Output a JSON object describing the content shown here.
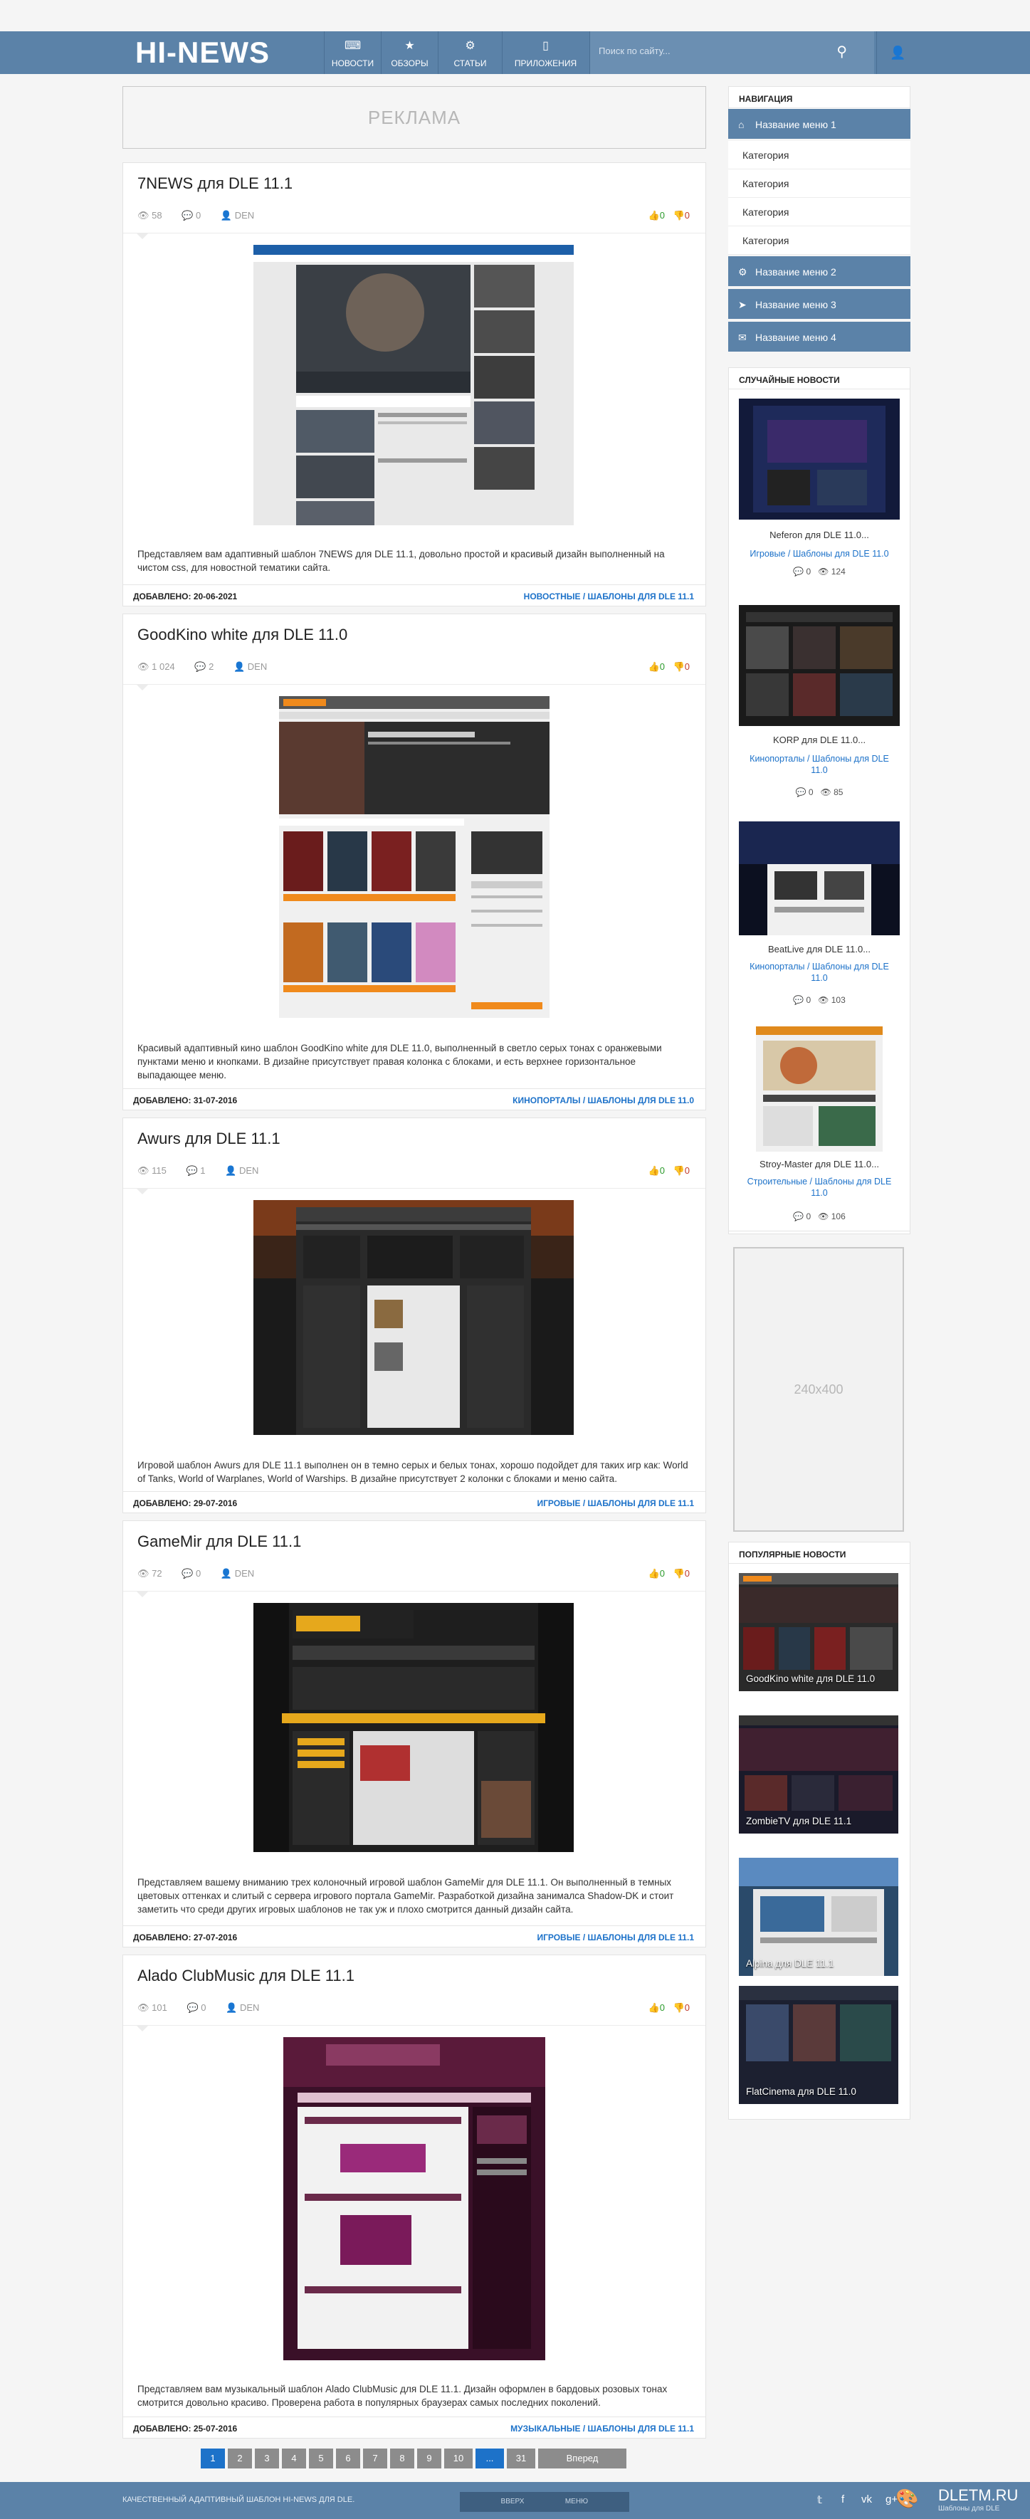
{
  "header": {
    "logo": "HI-NEWS",
    "nav": [
      {
        "label": "НОВОСТИ",
        "icon": "gamepad-icon"
      },
      {
        "label": "ОБЗОРЫ",
        "icon": "star-icon"
      },
      {
        "label": "СТАТЬИ",
        "icon": "gear-icon"
      },
      {
        "label": "ПРИЛОЖЕНИЯ",
        "icon": "phone-icon"
      }
    ],
    "search_placeholder": "Поиск по сайту...",
    "colors": {
      "bar": "#5b82a8",
      "accent": "#1d72c9"
    }
  },
  "ad": {
    "label": "РЕКЛАМА"
  },
  "posts": [
    {
      "title": "7NEWS для DLE 11.1",
      "views": "58",
      "comments": "0",
      "author": "DEN",
      "likes": "0",
      "dislikes": "0",
      "text": "Представляем вам адаптивный шаблон 7NEWS для DLE 11.1, довольно простой и красивый дизайн выполненный на чистом css, для новостной тематики сайта.",
      "date": "ДОБАВЛЕНО: 20-06-2021",
      "category": "НОВОСТНЫЕ / ШАБЛОНЫ ДЛЯ DLE 11.1"
    },
    {
      "title": "GoodKino white для DLE 11.0",
      "views": "1 024",
      "comments": "2",
      "author": "DEN",
      "likes": "0",
      "dislikes": "0",
      "text": "Красивый адаптивный кино шаблон GoodKino white для DLE 11.0, выполненный в светло серых тонах с оранжевыми пунктами меню и кнопками. В дизайне присутствует правая колонка с блоками, и есть верхнее горизонтальное выпадающее меню.",
      "date": "ДОБАВЛЕНО: 31-07-2016",
      "category": "КИНОПОРТАЛЫ / ШАБЛОНЫ ДЛЯ DLE 11.0"
    },
    {
      "title": "Awurs для DLE 11.1",
      "views": "115",
      "comments": "1",
      "author": "DEN",
      "likes": "0",
      "dislikes": "0",
      "text": "Игровой шаблон Awurs для DLE 11.1 выполнен он в темно серых и белых тонах, хорошо подойдет для таких игр как: World of Tanks, World of Warplanes, World of Warships. В дизайне присутствует 2 колонки с блоками и меню сайта.",
      "date": "ДОБАВЛЕНО: 29-07-2016",
      "category": "ИГРОВЫЕ / ШАБЛОНЫ ДЛЯ DLE 11.1"
    },
    {
      "title": "GameMir для DLE 11.1",
      "views": "72",
      "comments": "0",
      "author": "DEN",
      "likes": "0",
      "dislikes": "0",
      "text": "Представляем вашему вниманию трех колоночный игровой шаблон GameMir для DLE 11.1. Он выполненный в темных цветовых оттенках и слитый с сервера игрового портала GameMir. Разработкой дизайна занималса Shadow-DK и стоит заметить что среди других игровых шаблонов не так уж и плохо смотрится данный дизайн сайта.",
      "date": "ДОБАВЛЕНО: 27-07-2016",
      "category": "ИГРОВЫЕ / ШАБЛОНЫ ДЛЯ DLE 11.1"
    },
    {
      "title": "Alado ClubMusic для DLE 11.1",
      "views": "101",
      "comments": "0",
      "author": "DEN",
      "likes": "0",
      "dislikes": "0",
      "text": "Представляем вам музыкальный шаблон Alado ClubMusic для DLE 11.1. Дизайн оформлен в бардовых розовых тонах смотрится довольно красиво. Проверена работа в популярных браузерах самых последних поколений.",
      "date": "ДОБАВЛЕНО: 25-07-2016",
      "category": "МУЗЫКАЛЬНЫЕ / ШАБЛОНЫ ДЛЯ DLE 11.1"
    }
  ],
  "sidebar": {
    "nav_title": "НАВИГАЦИЯ",
    "menu": [
      {
        "label": "Название меню 1",
        "icon": "home-icon"
      },
      {
        "label": "Название меню 2",
        "icon": "gear-icon"
      },
      {
        "label": "Название меню 3",
        "icon": "location-arrow-icon"
      },
      {
        "label": "Название меню 4",
        "icon": "envelope-icon"
      }
    ],
    "submenu": [
      "Категория",
      "Категория",
      "Категория",
      "Категория"
    ],
    "random_title": "СЛУЧАЙНЫЕ НОВОСТИ",
    "random": [
      {
        "title": "Neferon для DLE 11.0...",
        "category": "Игровые / Шаблоны для DLE 11.0",
        "comments": "0",
        "views": "124"
      },
      {
        "title": "KORP для DLE 11.0...",
        "category": "Кинопорталы / Шаблоны для DLE 11.0",
        "comments": "0",
        "views": "85"
      },
      {
        "title": "BeatLive для DLE 11.0...",
        "category": "Кинопорталы / Шаблоны для DLE 11.0",
        "comments": "0",
        "views": "103"
      },
      {
        "title": "Stroy-Master для DLE 11.0...",
        "category": "Строительные / Шаблоны для DLE 11.0",
        "comments": "0",
        "views": "106"
      }
    ],
    "banner": "240x400",
    "popular_title": "ПОПУЛЯРНЫЕ НОВОСТИ",
    "popular": [
      "GoodKino white для DLE 11.0",
      "ZombieTV для DLE 11.1",
      "Alpina для DLE 11.1",
      "FlatCinema для DLE 11.0"
    ]
  },
  "pagination": {
    "pages": [
      "1",
      "2",
      "3",
      "4",
      "5",
      "6",
      "7",
      "8",
      "9",
      "10",
      "...",
      "31"
    ],
    "next": "Вперед",
    "current": "1"
  },
  "footer": {
    "text": "КАЧЕСТВЕННЫЙ АДАПТИВНЫЙ ШАБЛОН HI-NEWS ДЛЯ DLE.",
    "btn1": "ВВЕРХ",
    "btn2": "МЕНЮ",
    "logo": "DLETM.RU",
    "logo_sub": "Шаблоны для DLE"
  }
}
